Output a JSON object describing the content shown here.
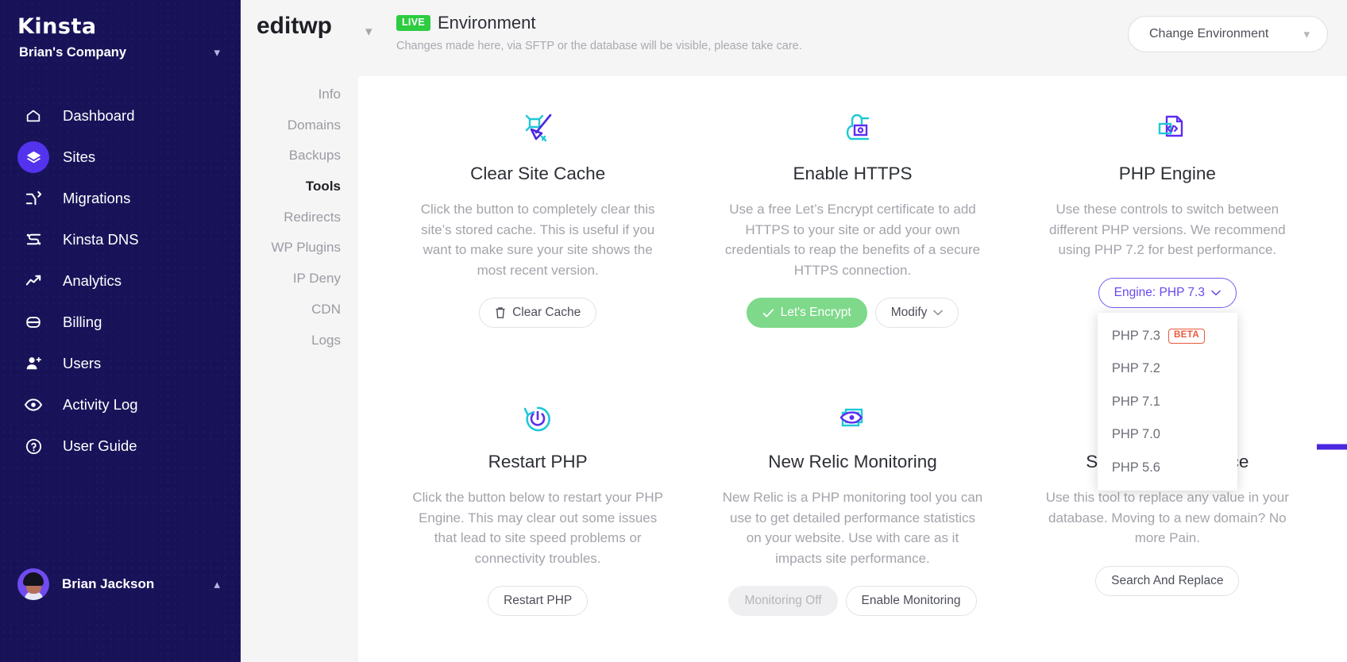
{
  "sidebar": {
    "logo": "Kinsta",
    "company": "Brian's Company",
    "company_chevron": "chevron-down",
    "items": [
      {
        "label": "Dashboard",
        "icon": "home-icon",
        "active": false
      },
      {
        "label": "Sites",
        "icon": "layers-icon",
        "active": true
      },
      {
        "label": "Migrations",
        "icon": "migrations-icon",
        "active": false
      },
      {
        "label": "Kinsta DNS",
        "icon": "dns-icon",
        "active": false
      },
      {
        "label": "Analytics",
        "icon": "analytics-icon",
        "active": false
      },
      {
        "label": "Billing",
        "icon": "billing-icon",
        "active": false
      },
      {
        "label": "Users",
        "icon": "user-plus-icon",
        "active": false
      },
      {
        "label": "Activity Log",
        "icon": "eye-icon",
        "active": false
      },
      {
        "label": "User Guide",
        "icon": "question-circle-icon",
        "active": false
      }
    ],
    "user": {
      "name": "Brian Jackson",
      "avatar": "user-avatar",
      "chevron": "chevron-up"
    }
  },
  "subnav": {
    "items": [
      {
        "label": "Info",
        "active": false
      },
      {
        "label": "Domains",
        "active": false
      },
      {
        "label": "Backups",
        "active": false
      },
      {
        "label": "Tools",
        "active": true
      },
      {
        "label": "Redirects",
        "active": false
      },
      {
        "label": "WP Plugins",
        "active": false
      },
      {
        "label": "IP Deny",
        "active": false
      },
      {
        "label": "CDN",
        "active": false
      },
      {
        "label": "Logs",
        "active": false
      }
    ]
  },
  "header": {
    "site_name": "editwp",
    "site_chevron": "chevron-down",
    "badge": "LIVE",
    "environment_title": "Environment",
    "environment_note": "Changes made here, via SFTP or the database will be visible, please take care.",
    "change_environment": "Change Environment",
    "change_environment_chevron": "chevron-down"
  },
  "cards": [
    {
      "icon": "broom-icon",
      "title": "Clear Site Cache",
      "description": "Click the button to completely clear this site’s stored cache. This is useful if you want to make sure your site shows the most recent version.",
      "buttons": [
        {
          "label": "Clear Cache",
          "style": "default",
          "icon": "trash-icon"
        }
      ]
    },
    {
      "icon": "unlocked-padlock-icon",
      "title": "Enable HTTPS",
      "description": "Use a free Let’s Encrypt certificate to add HTTPS to your site or add your own credentials to reap the benefits of a secure HTTPS connection.",
      "buttons": [
        {
          "label": "Let's Encrypt",
          "style": "green",
          "icon": "check-icon"
        },
        {
          "label": "Modify",
          "style": "default",
          "icon": "chevron-down-icon"
        }
      ]
    },
    {
      "icon": "code-file-icon",
      "title": "PHP Engine",
      "description": "Use these controls to switch between different PHP versions. We recommend using PHP 7.2 for best performance.",
      "buttons": [
        {
          "label": "Engine: PHP 7.3",
          "style": "purple",
          "icon": "chevron-down-icon"
        }
      ],
      "dropdown": {
        "open": true,
        "options": [
          {
            "label": "PHP 7.3",
            "badge": "BETA"
          },
          {
            "label": "PHP 7.2",
            "badge": ""
          },
          {
            "label": "PHP 7.1",
            "badge": ""
          },
          {
            "label": "PHP 7.0",
            "badge": ""
          },
          {
            "label": "PHP 5.6",
            "badge": ""
          }
        ]
      }
    },
    {
      "icon": "restart-power-icon",
      "title": "Restart PHP",
      "description": "Click the button below to restart your PHP Engine. This may clear out some issues that lead to site speed problems or connectivity troubles.",
      "buttons": [
        {
          "label": "Restart PHP",
          "style": "default",
          "icon": ""
        }
      ]
    },
    {
      "icon": "monitoring-eye-icon",
      "title": "New Relic Monitoring",
      "description": "New Relic is a PHP monitoring tool you can use to get detailed performance statistics on your website. Use with care as it impacts site performance.",
      "buttons": [
        {
          "label": "Monitoring Off",
          "style": "muted",
          "icon": ""
        },
        {
          "label": "Enable Monitoring",
          "style": "default",
          "icon": ""
        }
      ]
    },
    {
      "icon": "search-replace-icon",
      "title": "Search And Replace",
      "description": "Use this tool to replace any value in your database. Moving to a new domain? No more Pain.",
      "buttons": [
        {
          "label": "Search And Replace",
          "style": "default",
          "icon": ""
        }
      ]
    }
  ],
  "annotation": {
    "type": "arrow-right",
    "color": "#4a27e0"
  },
  "colors": {
    "sidebar_bg": "#181359",
    "accent_purple": "#5333ed",
    "live_green": "#2ecc41",
    "button_green": "#7ed98a",
    "beta_red": "#ea5a3d",
    "icon_teal": "#1fc8d8"
  }
}
